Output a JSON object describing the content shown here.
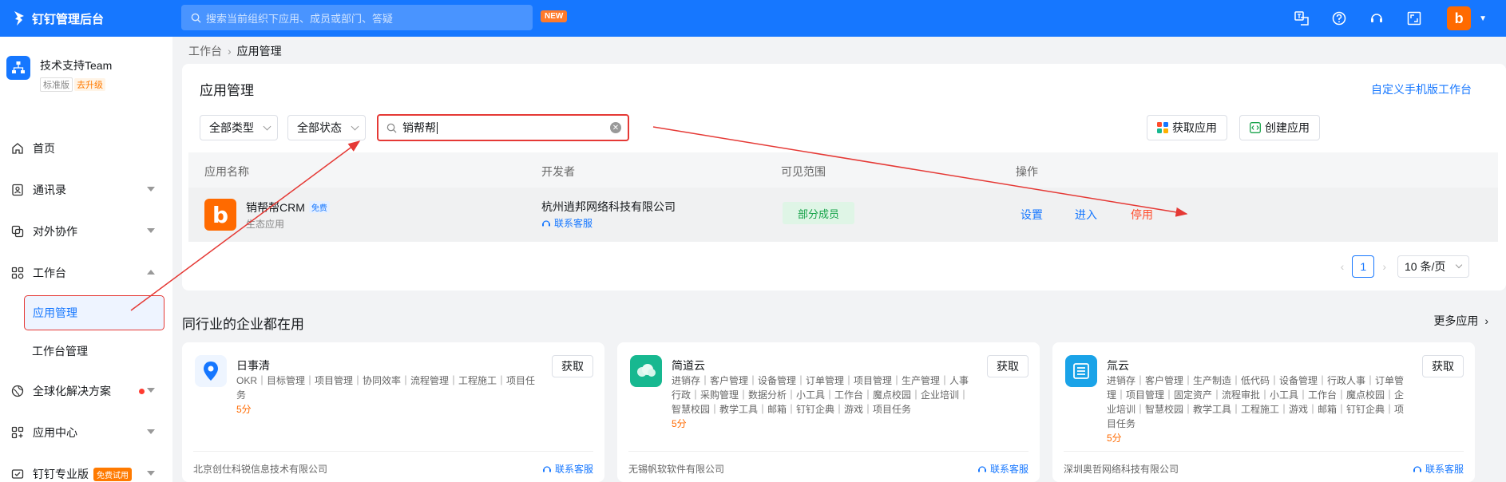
{
  "topbar": {
    "app_title": "钉钉管理后台",
    "search_placeholder": "搜索当前组织下应用、成员或部门、答疑",
    "new_badge": "NEW",
    "avatar_letter": "b"
  },
  "sidebar": {
    "team_name": "技术支持Team",
    "edition_tag": "标准版",
    "upgrade_tag": "去升级",
    "items": [
      {
        "label": "首页",
        "icon": "home-icon"
      },
      {
        "label": "通讯录",
        "icon": "contacts-icon"
      },
      {
        "label": "对外协作",
        "icon": "collaboration-icon"
      },
      {
        "label": "工作台",
        "icon": "workbench-icon"
      },
      {
        "label": "应用管理"
      },
      {
        "label": "工作台管理"
      },
      {
        "label": "全球化解决方案",
        "icon": "globe-icon"
      },
      {
        "label": "应用中心",
        "icon": "app-center-icon"
      },
      {
        "label": "钉钉专业版",
        "icon": "pro-icon",
        "badge": "免费试用"
      }
    ]
  },
  "breadcrumb": {
    "parent": "工作台",
    "current": "应用管理"
  },
  "main": {
    "title": "应用管理",
    "custom_link": "自定义手机版工作台",
    "filter_type": "全部类型",
    "filter_status": "全部状态",
    "search_value": "销帮帮",
    "get_app_button": "获取应用",
    "create_app_button": "创建应用",
    "columns": [
      "应用名称",
      "开发者",
      "可见范围",
      "操作"
    ],
    "rows": [
      {
        "name": "销帮帮CRM",
        "free_tag": "免费",
        "type": "生态应用",
        "developer": "杭州逍邦网络科技有限公司",
        "developer_link": "联系客服",
        "scope": "部分成员",
        "actions": [
          "设置",
          "进入",
          "停用"
        ]
      }
    ],
    "pager": {
      "prev": "‹",
      "current": "1",
      "next": "›",
      "page_size": "10 条/页"
    }
  },
  "industry": {
    "title": "同行业的企业都在用",
    "more_link": "更多应用",
    "cards": [
      {
        "name": "日事清",
        "tags": "OKR｜目标管理｜项目管理｜协同效率｜流程管理｜工程施工｜项目任务",
        "score": "5分",
        "button": "获取",
        "company": "北京创仕科锐信息技术有限公司",
        "service": "联系客服",
        "icon": "map-pin-icon",
        "color": "#1677ff"
      },
      {
        "name": "简道云",
        "tags": "进销存｜客户管理｜设备管理｜订单管理｜项目管理｜生产管理｜人事行政｜采购管理｜数据分析｜小工具｜工作台｜魔点校园｜企业培训｜智慧校园｜教学工具｜邮箱｜钉钉企典｜游戏｜项目任务",
        "score": "5分",
        "button": "获取",
        "company": "无锡帆软软件有限公司",
        "service": "联系客服",
        "icon": "cloud-icon",
        "color": "#17b890"
      },
      {
        "name": "氚云",
        "tags": "进销存｜客户管理｜生产制造｜低代码｜设备管理｜行政人事｜订单管理｜项目管理｜固定资产｜流程审批｜小工具｜工作台｜魔点校园｜企业培训｜智慧校园｜教学工具｜工程施工｜游戏｜邮箱｜钉钉企典｜项目任务",
        "score": "5分",
        "button": "获取",
        "company": "深圳奥哲网络科技有限公司",
        "service": "联系客服",
        "icon": "building-icon",
        "color": "#1aa3e8"
      }
    ]
  },
  "colors": {
    "brand": "#1677ff",
    "annotation": "#e53935",
    "stop_action": "#ff4d2d",
    "scope_tag": "#17a34a"
  }
}
